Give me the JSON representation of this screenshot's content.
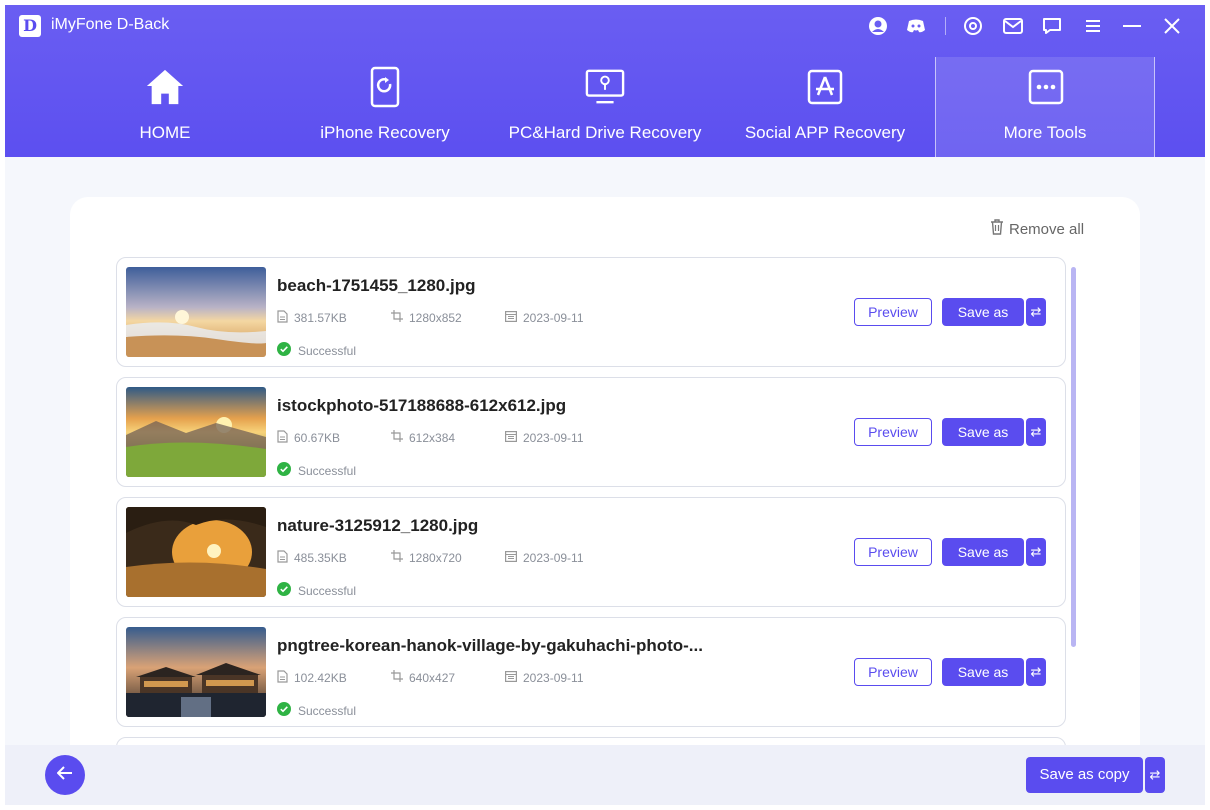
{
  "app": {
    "logo_letter": "D",
    "title": "iMyFone D-Back"
  },
  "titlebar_icons": [
    "account-icon",
    "discord-icon",
    "target-icon",
    "mail-icon",
    "chat-icon",
    "menu-icon",
    "minimize-icon",
    "close-icon"
  ],
  "nav": [
    {
      "label": "HOME",
      "icon": "home-icon",
      "active": false
    },
    {
      "label": "iPhone Recovery",
      "icon": "iphone-recovery-icon",
      "active": false
    },
    {
      "label": "PC&Hard Drive Recovery",
      "icon": "pc-drive-icon",
      "active": false
    },
    {
      "label": "Social APP Recovery",
      "icon": "app-store-icon",
      "active": false
    },
    {
      "label": "More Tools",
      "icon": "more-dots-icon",
      "active": true
    }
  ],
  "toolbar": {
    "remove_all": "Remove all"
  },
  "files": [
    {
      "name": "beach-1751455_1280.jpg",
      "size": "381.57KB",
      "dimensions": "1280x852",
      "date": "2023-09-11",
      "status": "Successful"
    },
    {
      "name": "istockphoto-517188688-612x612.jpg",
      "size": "60.67KB",
      "dimensions": "612x384",
      "date": "2023-09-11",
      "status": "Successful"
    },
    {
      "name": "nature-3125912_1280.jpg",
      "size": "485.35KB",
      "dimensions": "1280x720",
      "date": "2023-09-11",
      "status": "Successful"
    },
    {
      "name": "pngtree-korean-hanok-village-by-gakuhachi-photo-...",
      "size": "102.42KB",
      "dimensions": "640x427",
      "date": "2023-09-11",
      "status": "Successful"
    }
  ],
  "row_actions": {
    "preview": "Preview",
    "save_as": "Save as",
    "swap": "⇄"
  },
  "footer": {
    "save_copy": "Save as copy",
    "swap": "⇄"
  },
  "colors": {
    "brand": "#5a4cef",
    "header": "#6258f1",
    "success": "#2fb344"
  }
}
